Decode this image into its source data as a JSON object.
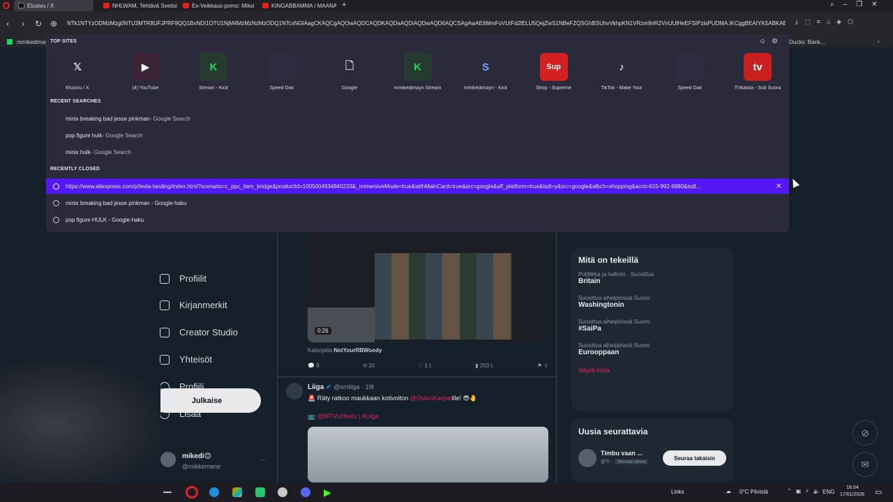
{
  "browser": {
    "tabs": [
      {
        "label": "Etusivu / X",
        "active": true
      },
      {
        "label": "NHLWAM, Tehtävä Sveitsi",
        "active": false
      },
      {
        "label": "Ex-Veikkaus-pomo: Miksi",
        "active": false
      },
      {
        "label": "KINGABBAMMA / MAANANTAI",
        "active": false
      }
    ],
    "url": "NTk1NTYzODMzMzg0NTU3MTR8UFJPRF9QQ1BxNDI1OTU1NjM4MzMzNzMzODQ1NTcxNGlAagCKAQCgAQOwAQDCAQDKAQDaAQDiAQDwAQD6AQCSAgAwAEItMmFoVUtFd2lELU5QejZwS1NBeFZQSGhBSUhvVkhpKN1VRzm9nR2VnUUlHeEFSIPzlsPUDMA.IKCggBEAIYASABKAE",
    "bookmark_left": "mmikedimayn",
    "bookmark_right": "Ducks: Bank..."
  },
  "dropdown": {
    "top_sites_header": "TOP SITES",
    "top_sites": [
      {
        "label": "Etusivu / X",
        "icon": "x-logo-icon",
        "glyph": "𝕏",
        "bg": "#2a2a3b",
        "fg": "#ffffff"
      },
      {
        "label": "(4) YouTube",
        "icon": "youtube-icon",
        "glyph": "▶",
        "bg": "#3a2436",
        "fg": "#ffffff"
      },
      {
        "label": "Stream - Kick",
        "icon": "kick-icon",
        "glyph": "K",
        "bg": "#263a30",
        "fg": "#1bd760"
      },
      {
        "label": "Speed Dial",
        "icon": "speed-dial-icon",
        "glyph": "",
        "bg": "#2d2d3f",
        "fg": "#888"
      },
      {
        "label": "Google",
        "icon": "document-icon",
        "glyph": "🗋",
        "bg": "#2a2a3b",
        "fg": "#cfcfd8"
      },
      {
        "label": "mmikedimayn Stream",
        "icon": "kick-icon",
        "glyph": "K",
        "bg": "#263a30",
        "fg": "#1bd760"
      },
      {
        "label": "mmikedimayn - Kick",
        "icon": "swirl-icon",
        "glyph": "S",
        "bg": "#2a2a3b",
        "fg": "#7aa4ff"
      },
      {
        "label": "Shop - Supreme",
        "icon": "supreme-icon",
        "glyph": "Sup",
        "bg": "#d32020",
        "fg": "#ffffff"
      },
      {
        "label": "TikTok - Make Your",
        "icon": "tiktok-icon",
        "glyph": "♪",
        "bg": "#2a2a3b",
        "fg": "#ffffff"
      },
      {
        "label": "Speed Dial",
        "icon": "speed-dial-icon",
        "glyph": "",
        "bg": "#2d2d3f",
        "fg": "#888"
      },
      {
        "label": "TVkaista - Sub Suora",
        "icon": "tv-icon",
        "glyph": "tv",
        "bg": "#c8201e",
        "fg": "#ffffff"
      }
    ],
    "recent_searches_header": "RECENT SEARCHES",
    "recent_searches": [
      {
        "query": "minix breaking bad jesse pinkman",
        "source": " - Google Search"
      },
      {
        "query": "pop figure hulk",
        "source": " - Google Search"
      },
      {
        "query": "minix hulk",
        "source": " - Google Search"
      }
    ],
    "recently_closed_header": "RECENTLY CLOSED",
    "recently_closed": [
      {
        "text": "https://www.aliexpress.com/p/tesla-landing/index.html?scenario=c_ppc_item_bridge&productId=1005004934840233&_immersiveMode=true&withMainCard=true&src=google&aff_platform=true&isdl=y&src=google&albch=shopping&acnt=615-992-9880&isdl...",
        "selected": true
      },
      {
        "text": "minix breaking bad jesse pinkman - Google-haku",
        "selected": false
      },
      {
        "text": "pop figure HULK - Google-haku",
        "selected": false
      }
    ]
  },
  "x_page": {
    "nav": [
      "Profiilit",
      "Kirjanmerkit",
      "Creator Studio",
      "Yhteisöt",
      "Profiili",
      "Lisää"
    ],
    "post_button": "Julkaise",
    "account_name": "mikedi😊",
    "account_handle": "@mikkemane",
    "video_time": "0:26",
    "watched_label": "Katsojalta",
    "watched_user": "NotYourRBWoody",
    "stats": [
      "9",
      "20",
      "1 t.",
      "203 t."
    ],
    "tweet_author": "Liiga",
    "tweet_handle": "@smliiga · 19t",
    "tweet_text_a": "Räty ratkoo maukkaan kotivoiton ",
    "tweet_text_link": "@OulunKarpat",
    "tweet_text_b": "ille! 😎🤚",
    "tweet_hashtags": "@MTVUrheilu | #Liiga",
    "trends_title": "Mitä on tekeillä",
    "trends": [
      {
        "meta": "Politiikka ja hallinto · Suosittua",
        "name": "Britain"
      },
      {
        "meta": "Suosittua aiheipiirissä Suomi",
        "name": "Washingtonin"
      },
      {
        "meta": "Suosittua aiheipiirissä Suomi",
        "name": "#SaiPa"
      },
      {
        "meta": "Suosittua aiheipiirissä Suomi",
        "name": "Eurooppaan"
      }
    ],
    "show_more": "Näytä lisää",
    "follow_title": "Uusia seurattavia",
    "follow_name": "Timbu vaan ...",
    "follow_handle": "@Ti...",
    "follow_badge": "Seuraa sinua",
    "follow_button": "Seuraa takaisin"
  },
  "taskbar": {
    "links": "Links",
    "weather": "0°C  Pilvistä",
    "lang": "ENG",
    "time": "18.04",
    "date": "17/01/2026"
  },
  "colors": {
    "accent": "#5218f5",
    "twitter_bg": "#15202b",
    "dropdown_bg": "#2a2a3b"
  }
}
